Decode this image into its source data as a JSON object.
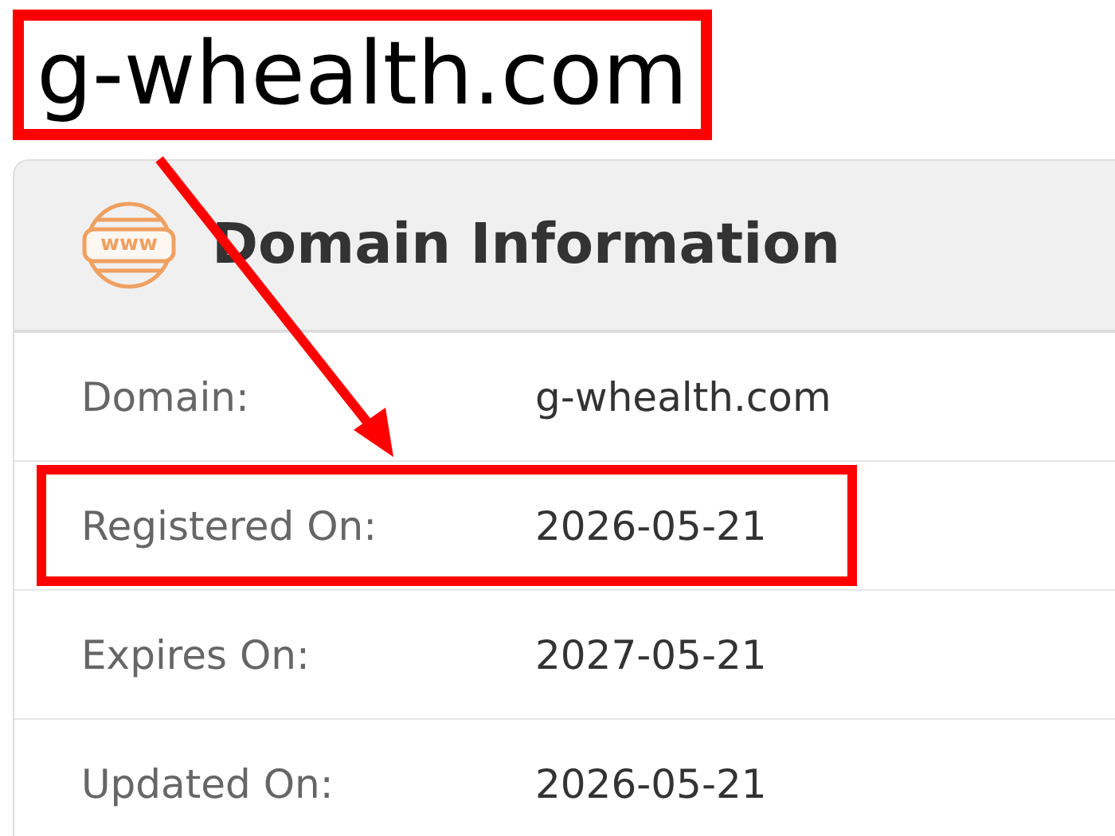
{
  "title": {
    "text": "g-whealth.com",
    "highlighted": true
  },
  "card": {
    "icon_label": "www",
    "heading": "Domain Information",
    "rows": [
      {
        "label": "Domain:",
        "value": "g-whealth.com",
        "highlighted": false
      },
      {
        "label": "Registered On:",
        "value": "2026-05-21",
        "highlighted": true
      },
      {
        "label": "Expires On:",
        "value": "2027-05-21",
        "highlighted": false
      },
      {
        "label": "Updated On:",
        "value": "2026-05-21",
        "highlighted": false
      }
    ]
  },
  "annotations": [
    {
      "kind": "arrow"
    }
  ]
}
